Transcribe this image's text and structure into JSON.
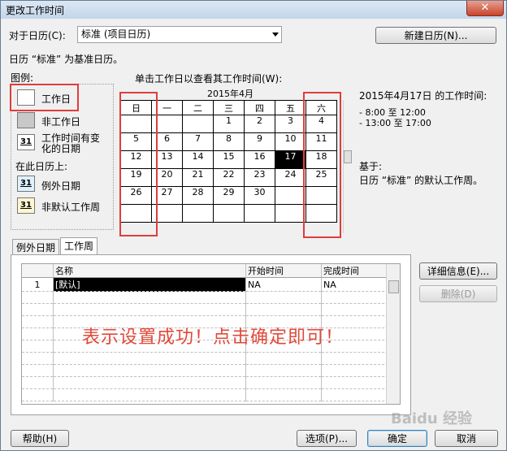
{
  "window": {
    "title": "更改工作时间",
    "close": "✕"
  },
  "calendar_for": {
    "label": "对于日历(C):",
    "value": "标准 (项目日历)",
    "new_button": "新建日历(N)...",
    "base_note": "日历 “标准” 为基准日历。"
  },
  "legend": {
    "title": "图例:",
    "items": [
      {
        "label": "工作日"
      },
      {
        "label": "非工作日"
      },
      {
        "label": "工作时间有变化的日期",
        "swatch": "31"
      }
    ],
    "on_this_calendar": "在此日历上:",
    "items2": [
      {
        "label": "例外日期",
        "swatch": "31"
      },
      {
        "label": "非默认工作周",
        "swatch": "31"
      }
    ]
  },
  "calendar": {
    "instruction": "单击工作日以查看其工作时间(W):",
    "month": "2015年4月",
    "weekdays": [
      "日",
      "一",
      "二",
      "三",
      "四",
      "五",
      "六"
    ],
    "weeks": [
      [
        "",
        "",
        "",
        "1",
        "2",
        "3",
        "4"
      ],
      [
        "5",
        "6",
        "7",
        "8",
        "9",
        "10",
        "11"
      ],
      [
        "12",
        "13",
        "14",
        "15",
        "16",
        "17",
        "18"
      ],
      [
        "19",
        "20",
        "21",
        "22",
        "23",
        "24",
        "25"
      ],
      [
        "26",
        "27",
        "28",
        "29",
        "30",
        "",
        ""
      ],
      [
        "",
        "",
        "",
        "",
        "",
        "",
        ""
      ]
    ],
    "selected": "17"
  },
  "work_time_info": {
    "heading": "2015年4月17日 的工作时间:",
    "ranges": [
      "- 8:00 至 12:00",
      "- 13:00 至 17:00"
    ],
    "based_on": "基于:",
    "based_detail": "日历 “标准” 的默认工作周。"
  },
  "tabs": [
    {
      "label": "例外日期"
    },
    {
      "label": "工作周"
    }
  ],
  "table": {
    "columns": [
      "",
      "名称",
      "开始时间",
      "完成时间"
    ],
    "rows": [
      {
        "num": "1",
        "name": "[默认]",
        "start": "NA",
        "finish": "NA"
      }
    ]
  },
  "side_buttons": {
    "details": "详细信息(E)...",
    "delete": "删除(D)"
  },
  "annotation": "表示设置成功！点击确定即可！",
  "footer": {
    "help": "帮助(H)",
    "options": "选项(P)...",
    "ok": "确定",
    "cancel": "取消"
  },
  "watermark": "Baidu 经验"
}
